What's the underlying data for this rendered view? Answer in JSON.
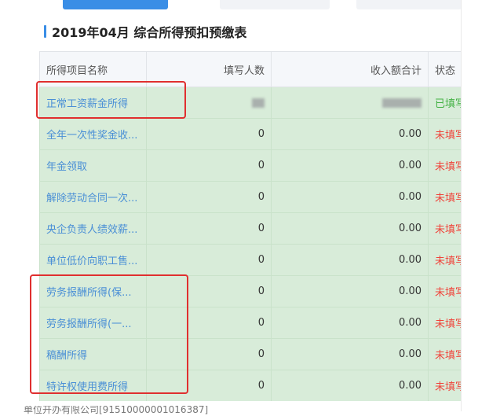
{
  "page": {
    "title": "2019年04月  综合所得预扣预缴表",
    "bottom_text": "单位开办有限公司[91510000001016387]"
  },
  "table": {
    "headers": {
      "name": "所得项目名称",
      "count": "填写人数",
      "income": "收入额合计",
      "status": "状态"
    },
    "rows": [
      {
        "name": "正常工资薪金所得",
        "count": "",
        "income": "",
        "status": "已填写",
        "masked": true
      },
      {
        "name": "全年一次性奖金收...",
        "count": "0",
        "income": "0.00",
        "status": "未填写"
      },
      {
        "name": "年金领取",
        "count": "0",
        "income": "0.00",
        "status": "未填写"
      },
      {
        "name": "解除劳动合同一次...",
        "count": "0",
        "income": "0.00",
        "status": "未填写"
      },
      {
        "name": "央企负责人绩效薪...",
        "count": "0",
        "income": "0.00",
        "status": "未填写"
      },
      {
        "name": "单位低价向职工售...",
        "count": "0",
        "income": "0.00",
        "status": "未填写"
      },
      {
        "name": "劳务报酬所得(保...",
        "count": "0",
        "income": "0.00",
        "status": "未填写"
      },
      {
        "name": "劳务报酬所得(一...",
        "count": "0",
        "income": "0.00",
        "status": "未填写"
      },
      {
        "name": "稿酬所得",
        "count": "0",
        "income": "0.00",
        "status": "未填写"
      },
      {
        "name": "特许权使用费所得",
        "count": "0",
        "income": "0.00",
        "status": "未填写"
      }
    ]
  },
  "colors": {
    "accent": "#3a8ee6",
    "row_bg": "#d8ecd9",
    "link": "#4a8fd6",
    "status_pending": "#f0433a",
    "status_done": "#43b244",
    "highlight_box": "#e02f2f"
  }
}
